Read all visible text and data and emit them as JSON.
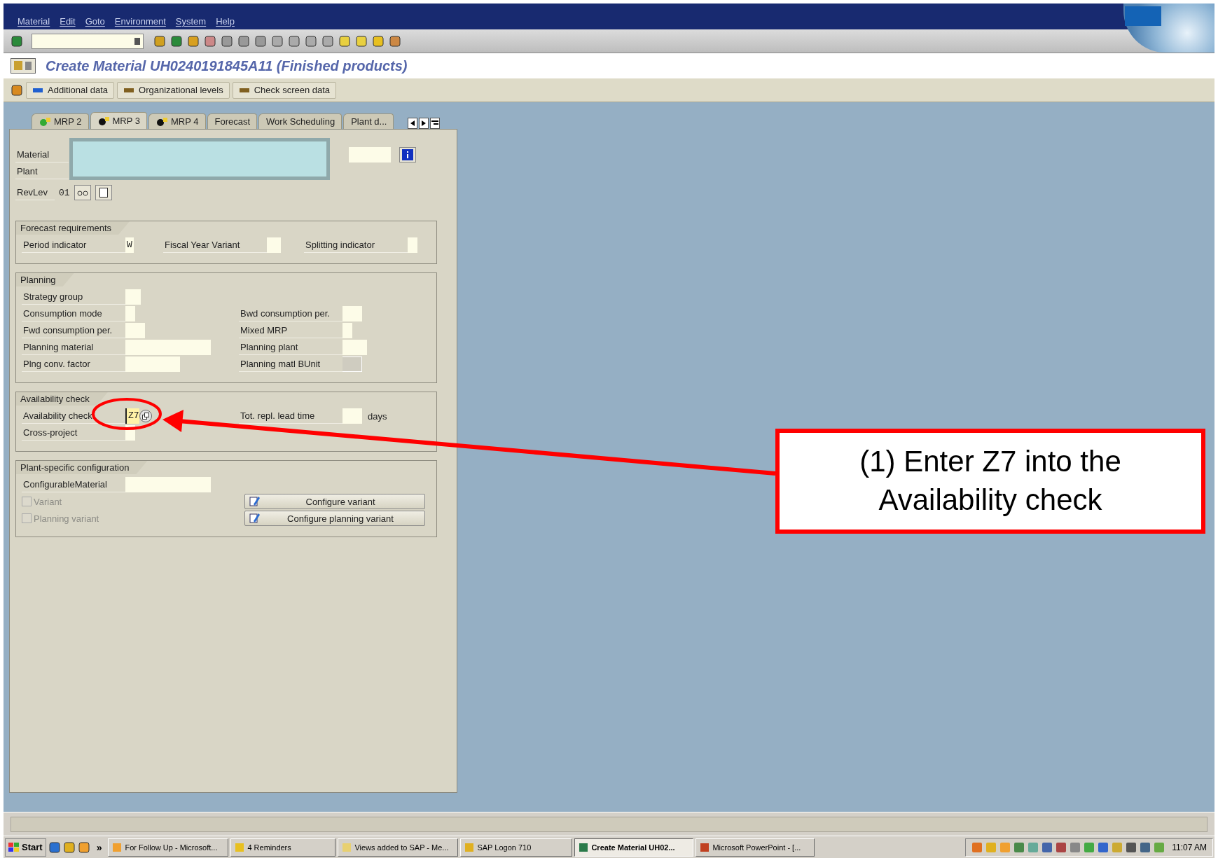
{
  "menu": [
    "Material",
    "Edit",
    "Goto",
    "Environment",
    "System",
    "Help"
  ],
  "title": "Create Material UH0240191845A11 (Finished products)",
  "app_toolbar": [
    "Additional data",
    "Organizational levels",
    "Check screen data"
  ],
  "tabs": [
    {
      "label": "MRP 2",
      "selected": false
    },
    {
      "label": "MRP 3",
      "selected": true
    },
    {
      "label": "MRP 4",
      "selected": false
    },
    {
      "label": "Forecast",
      "selected": false
    },
    {
      "label": "Work Scheduling",
      "selected": false
    },
    {
      "label": "Plant d...",
      "selected": false
    }
  ],
  "header": {
    "material_label": "Material",
    "plant_label": "Plant",
    "revlev_label": "RevLev",
    "revlev_value": "01"
  },
  "groups": [
    {
      "title": "Forecast requirements",
      "rows": [
        [
          {
            "label": "Period indicator",
            "value": "W"
          },
          {
            "label": "Fiscal Year Variant"
          },
          {
            "label": "Splitting indicator"
          }
        ]
      ]
    },
    {
      "title": "Planning",
      "rows": [
        [
          {
            "label": "Strategy group"
          },
          null
        ],
        [
          {
            "label": "Consumption mode"
          },
          {
            "label": "Bwd consumption per."
          }
        ],
        [
          {
            "label": "Fwd consumption per."
          },
          {
            "label": "Mixed MRP"
          }
        ],
        [
          {
            "label": "Planning material"
          },
          {
            "label": "Planning plant"
          }
        ],
        [
          {
            "label": "Plng conv. factor"
          },
          {
            "label": "Planning matl BUnit",
            "disabled": true
          }
        ]
      ]
    },
    {
      "title": "Availability check",
      "rows": [
        [
          {
            "label": "Availability check",
            "value": "Z7",
            "focused": true
          },
          {
            "label": "Tot. repl. lead time",
            "unit": "days"
          }
        ],
        [
          {
            "label": "Cross-project"
          },
          null
        ]
      ]
    },
    {
      "title": "Plant-specific configuration",
      "rows": [
        [
          {
            "label": "ConfigurableMaterial"
          },
          null
        ]
      ]
    }
  ],
  "config": [
    {
      "checkbox": "Variant",
      "checked": false,
      "disabled": true,
      "button": "Configure variant"
    },
    {
      "checkbox": "Planning variant",
      "checked": false,
      "disabled": true,
      "button": "Configure planning variant"
    }
  ],
  "callout": "(1) Enter Z7 into the Availability check",
  "taskbar": {
    "start": "Start",
    "more": "»",
    "items": [
      {
        "label": "For Follow Up - Microsoft...",
        "selected": false
      },
      {
        "label": "4 Reminders",
        "selected": false
      },
      {
        "label": "Views added to SAP - Me...",
        "selected": false
      },
      {
        "label": "SAP Logon 710",
        "selected": false
      },
      {
        "label": "Create Material UH02...",
        "selected": true
      },
      {
        "label": "Microsoft PowerPoint - [...",
        "selected": false
      }
    ],
    "clock": "11:07 AM"
  }
}
